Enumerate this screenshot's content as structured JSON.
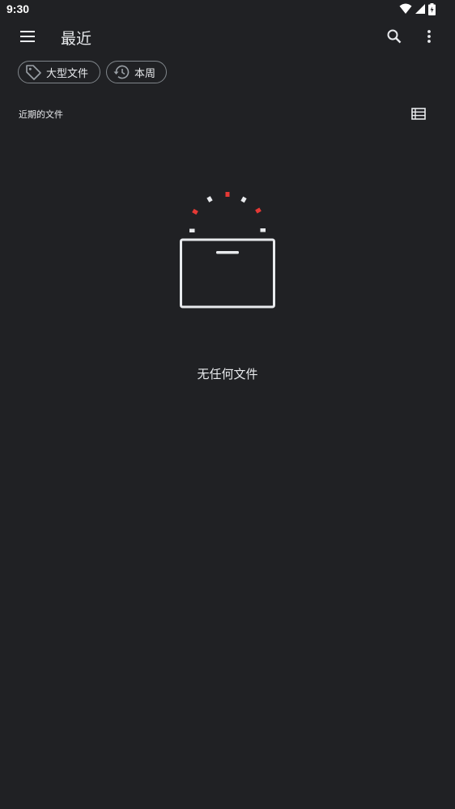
{
  "status_bar": {
    "time": "9:30"
  },
  "toolbar": {
    "title": "最近",
    "menu_icon": "menu-icon",
    "search_icon": "search-icon",
    "more_icon": "more-vert-icon"
  },
  "filters": [
    {
      "label": "大型文件",
      "icon": "tag-icon"
    },
    {
      "label": "本周",
      "icon": "history-icon"
    }
  ],
  "section": {
    "title": "近期的文件",
    "view_toggle_icon": "list-view-icon"
  },
  "empty_state": {
    "message": "无任何文件"
  },
  "colors": {
    "background": "#202124",
    "text": "#e8eaed",
    "accent_red": "#e53935",
    "chip_border": "#80868b"
  }
}
